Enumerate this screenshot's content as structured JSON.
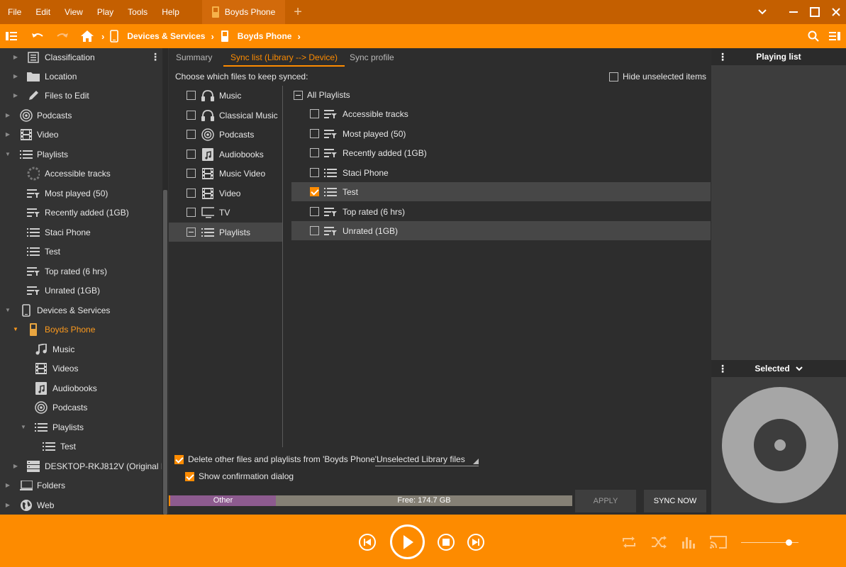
{
  "menu": [
    "File",
    "Edit",
    "View",
    "Play",
    "Tools",
    "Help"
  ],
  "window_tab": "Boyds Phone",
  "window_tab_add": "+",
  "breadcrumb": [
    "Devices & Services",
    "Boyds Phone"
  ],
  "tree": {
    "classification": "Classification",
    "location": "Location",
    "files_to_edit": "Files to Edit",
    "podcasts": "Podcasts",
    "video": "Video",
    "playlists": "Playlists",
    "accessible": "Accessible tracks",
    "most_played": "Most played (50)",
    "recently_added": "Recently added (1GB)",
    "staci_phone": "Staci Phone",
    "test": "Test",
    "top_rated": "Top rated (6 hrs)",
    "unrated": "Unrated (1GB)",
    "devices": "Devices & Services",
    "boyds_phone": "Boyds Phone",
    "music": "Music",
    "videos": "Videos",
    "audiobooks": "Audiobooks",
    "dev_podcasts": "Podcasts",
    "dev_playlists": "Playlists",
    "dev_test": "Test",
    "desktop": "DESKTOP-RKJ812V (Original For",
    "folders": "Folders",
    "web": "Web"
  },
  "tabs": {
    "summary": "Summary",
    "sync_list": "Sync list (Library --> Device)",
    "sync_profile": "Sync profile"
  },
  "sync": {
    "choose_label": "Choose which files to keep synced:",
    "hide_unselected": "Hide unselected items",
    "categories": [
      "Music",
      "Classical Music",
      "Podcasts",
      "Audiobooks",
      "Music Video",
      "Video",
      "TV",
      "Playlists"
    ],
    "all_playlists": "All Playlists",
    "playlists": [
      "Accessible tracks",
      "Most played (50)",
      "Recently added (1GB)",
      "Staci Phone",
      "Test",
      "Top rated (6 hrs)",
      "Unrated (1GB)"
    ],
    "delete_label": "Delete other files and playlists from 'Boyds Phone':",
    "delete_select": "Unselected Library files",
    "confirm_label": "Show confirmation dialog",
    "storage_other": "Other",
    "storage_free": "Free: 174.7 GB",
    "storage_other_fraction": 0.265,
    "apply": "APPLY",
    "sync_now": "SYNC NOW"
  },
  "right_panel": {
    "playing_list": "Playing list",
    "selected": "Selected"
  },
  "player": {
    "volume_fraction": 0.83
  },
  "colors": {
    "accent": "#fd8b00",
    "menubar": "#c45f00",
    "storage_other": "#8d5b8f",
    "storage_free": "#858075"
  }
}
